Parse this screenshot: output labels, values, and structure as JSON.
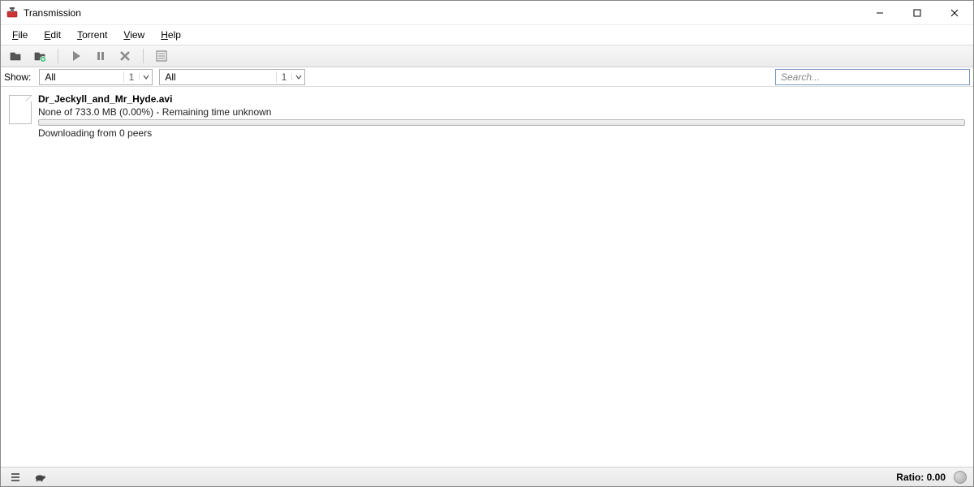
{
  "window": {
    "title": "Transmission",
    "icon": "transmission-icon"
  },
  "menu": {
    "file": "File",
    "edit": "Edit",
    "torrent": "Torrent",
    "view": "View",
    "help": "Help"
  },
  "toolbar": {
    "open": "open-torrent-icon",
    "open_url": "open-url-icon",
    "start": "start-icon",
    "pause": "pause-icon",
    "remove": "remove-icon",
    "properties": "properties-icon"
  },
  "filter": {
    "label": "Show:",
    "combo1": {
      "value": "All",
      "count": "1"
    },
    "combo2": {
      "value": "All",
      "count": "1"
    },
    "search_placeholder": "Search..."
  },
  "torrents": [
    {
      "name": "Dr_Jeckyll_and_Mr_Hyde.avi",
      "status": "None of 733.0 MB (0.00%) - Remaining time unknown",
      "peers": "Downloading from 0 peers",
      "progress": 0
    }
  ],
  "statusbar": {
    "ratio_label": "Ratio:",
    "ratio_value": "0.00"
  }
}
